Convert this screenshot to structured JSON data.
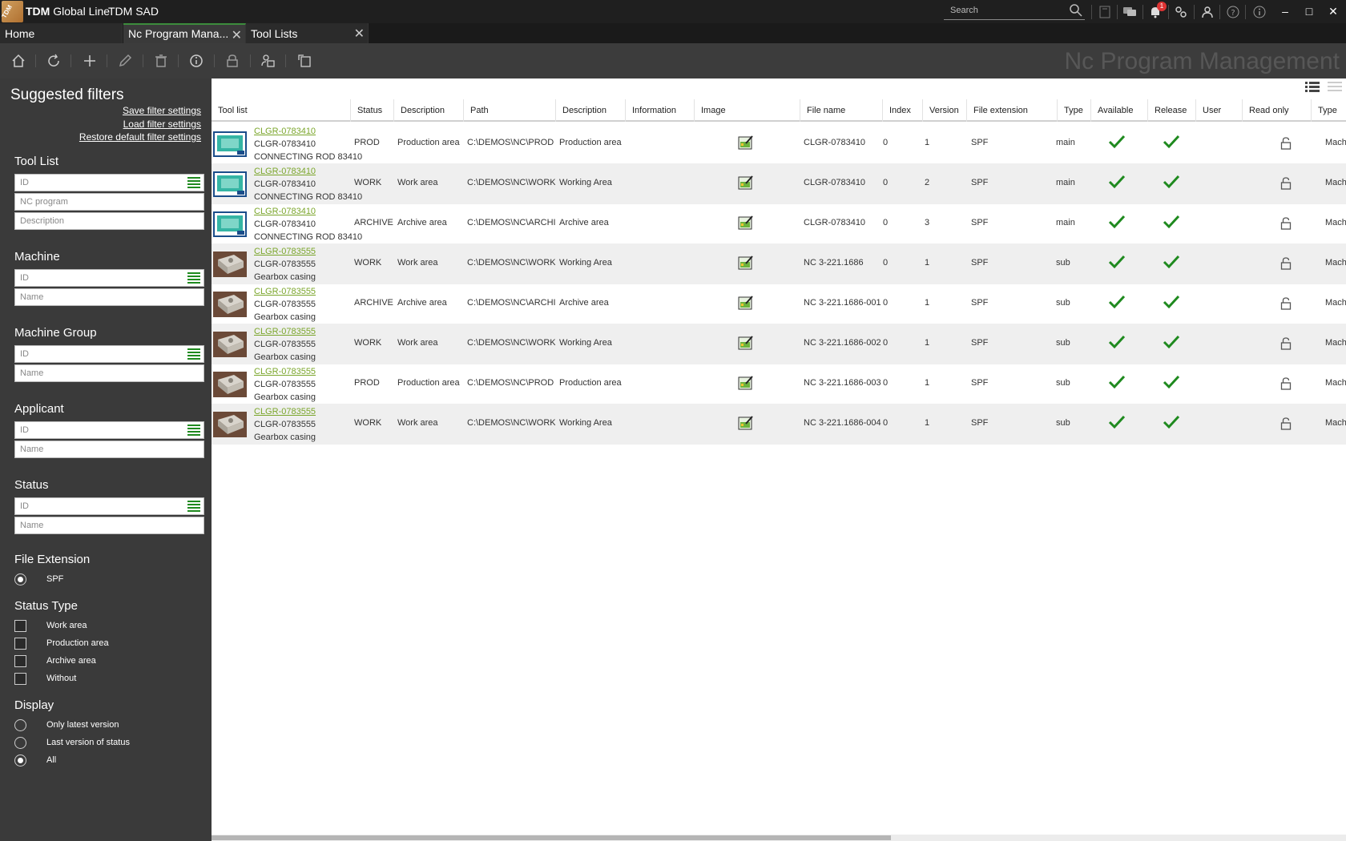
{
  "titlebar": {
    "brand": "TDM",
    "product": "Global Line",
    "instance": "TDM SAD",
    "search_placeholder": "Search",
    "notification_count": "1"
  },
  "tabs": [
    {
      "label": "Home"
    },
    {
      "label": "Nc Program Mana..."
    },
    {
      "label": "Tool Lists"
    }
  ],
  "page_heading": "Nc Program Management",
  "sidebar": {
    "title": "Suggested filters",
    "links": [
      "Save filter settings",
      "Load filter settings",
      "Restore default filter settings"
    ],
    "tool_list": {
      "title": "Tool List",
      "fields": [
        "ID",
        "NC program",
        "Description"
      ]
    },
    "machine": {
      "title": "Machine",
      "fields": [
        "ID",
        "Name"
      ]
    },
    "machine_group": {
      "title": "Machine Group",
      "fields": [
        "ID",
        "Name"
      ]
    },
    "applicant": {
      "title": "Applicant",
      "fields": [
        "ID",
        "Name"
      ]
    },
    "status": {
      "title": "Status",
      "fields": [
        "ID",
        "Name"
      ]
    },
    "file_extension": {
      "title": "File Extension",
      "options": [
        {
          "label": "SPF",
          "selected": true
        }
      ]
    },
    "status_type": {
      "title": "Status Type",
      "options": [
        {
          "label": "Work area",
          "checked": false
        },
        {
          "label": "Production area",
          "checked": false
        },
        {
          "label": "Archive area",
          "checked": false
        },
        {
          "label": "Without",
          "checked": false
        }
      ]
    },
    "display": {
      "title": "Display",
      "options": [
        {
          "label": "Only latest version",
          "selected": false
        },
        {
          "label": "Last version of status",
          "selected": false
        },
        {
          "label": "All",
          "selected": true
        }
      ]
    }
  },
  "grid": {
    "columns": [
      "Tool list",
      "Status",
      "Description",
      "Path",
      "Description",
      "Information",
      "Image",
      "File name",
      "Index",
      "Version",
      "File extension",
      "Type",
      "Available",
      "Release",
      "User",
      "Read only",
      "Type"
    ],
    "rows": [
      {
        "thumb": "screen",
        "link": "CLGR-0783410",
        "id": "CLGR-0783410",
        "desc": "CONNECTING ROD 83410",
        "status": "PROD",
        "status_desc": "Production area",
        "path": "C:\\DEMOS\\NC\\PROD",
        "area_desc": "Production area",
        "file_name": "CLGR-0783410",
        "index": "0",
        "version": "1",
        "ext": "SPF",
        "type": "main",
        "last_type": "Mach"
      },
      {
        "thumb": "screen",
        "link": "CLGR-0783410",
        "id": "CLGR-0783410",
        "desc": "CONNECTING ROD 83410",
        "status": "WORK",
        "status_desc": "Work area",
        "path": "C:\\DEMOS\\NC\\WORK",
        "area_desc": "Working Area",
        "file_name": "CLGR-0783410",
        "index": "0",
        "version": "2",
        "ext": "SPF",
        "type": "main",
        "last_type": "Mach"
      },
      {
        "thumb": "screen",
        "link": "CLGR-0783410",
        "id": "CLGR-0783410",
        "desc": "CONNECTING ROD 83410",
        "status": "ARCHIVE",
        "status_desc": "Archive area",
        "path": "C:\\DEMOS\\NC\\ARCHIV",
        "area_desc": "Archive area",
        "file_name": "CLGR-0783410",
        "index": "0",
        "version": "3",
        "ext": "SPF",
        "type": "main",
        "last_type": "Mach"
      },
      {
        "thumb": "part",
        "link": "CLGR-0783555",
        "id": "CLGR-0783555",
        "desc": "Gearbox casing",
        "status": "WORK",
        "status_desc": "Work area",
        "path": "C:\\DEMOS\\NC\\WORK",
        "area_desc": "Working Area",
        "file_name": "NC 3-221.1686",
        "index": "0",
        "version": "1",
        "ext": "SPF",
        "type": "sub",
        "last_type": "Mach"
      },
      {
        "thumb": "part",
        "link": "CLGR-0783555",
        "id": "CLGR-0783555",
        "desc": "Gearbox casing",
        "status": "ARCHIVE",
        "status_desc": "Archive area",
        "path": "C:\\DEMOS\\NC\\ARCHIV",
        "area_desc": "Archive area",
        "file_name": "NC 3-221.1686-001",
        "index": "0",
        "version": "1",
        "ext": "SPF",
        "type": "sub",
        "last_type": "Mach"
      },
      {
        "thumb": "part",
        "link": "CLGR-0783555",
        "id": "CLGR-0783555",
        "desc": "Gearbox casing",
        "status": "WORK",
        "status_desc": "Work area",
        "path": "C:\\DEMOS\\NC\\WORK",
        "area_desc": "Working Area",
        "file_name": "NC 3-221.1686-002",
        "index": "0",
        "version": "1",
        "ext": "SPF",
        "type": "sub",
        "last_type": "Mach"
      },
      {
        "thumb": "part",
        "link": "CLGR-0783555",
        "id": "CLGR-0783555",
        "desc": "Gearbox casing",
        "status": "PROD",
        "status_desc": "Production area",
        "path": "C:\\DEMOS\\NC\\PROD",
        "area_desc": "Production area",
        "file_name": "NC 3-221.1686-003",
        "index": "0",
        "version": "1",
        "ext": "SPF",
        "type": "sub",
        "last_type": "Mach"
      },
      {
        "thumb": "part",
        "link": "CLGR-0783555",
        "id": "CLGR-0783555",
        "desc": "Gearbox casing",
        "status": "WORK",
        "status_desc": "Work area",
        "path": "C:\\DEMOS\\NC\\WORK",
        "area_desc": "Working Area",
        "file_name": "NC 3-221.1686-004",
        "index": "0",
        "version": "1",
        "ext": "SPF",
        "type": "sub",
        "last_type": "Mach"
      }
    ]
  },
  "colors": {
    "accent_green": "#1f8a1f",
    "link_green": "#7aa52a",
    "title_bg": "#1f1f1f",
    "sidebar_bg": "#3a3a3a"
  }
}
